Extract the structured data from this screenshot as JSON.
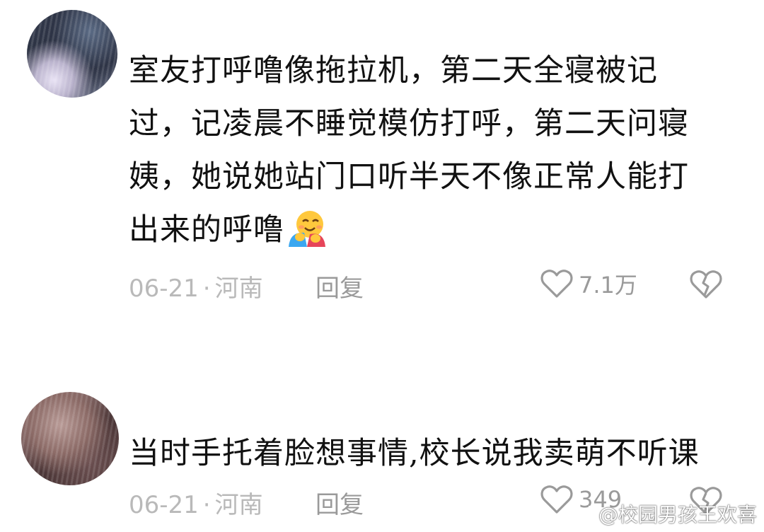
{
  "comments": [
    {
      "text": "室友打呼噜像拖拉机，第二天全寝被记过，记凌晨不睡觉模仿打呼，第二天问寝姨，她说她站门口听半天不像正常人能打出来的呼噜",
      "emoji": "hugging-face-emoji",
      "date": "06-21",
      "separator": "·",
      "location": "河南",
      "reply_label": "回复",
      "like_count": "7.1万"
    },
    {
      "text": "当时手托着脸想事情,校长说我卖萌不听课",
      "date": "06-21",
      "separator": "·",
      "location": "河南",
      "reply_label": "回复",
      "like_count": "349"
    }
  ],
  "watermark": {
    "text": "@校园男孩王欢喜",
    "icon": "weibo-logo"
  },
  "colors": {
    "meta_gray": "#b9b9b9",
    "action_gray": "#9a9a9a",
    "text": "#111111"
  }
}
